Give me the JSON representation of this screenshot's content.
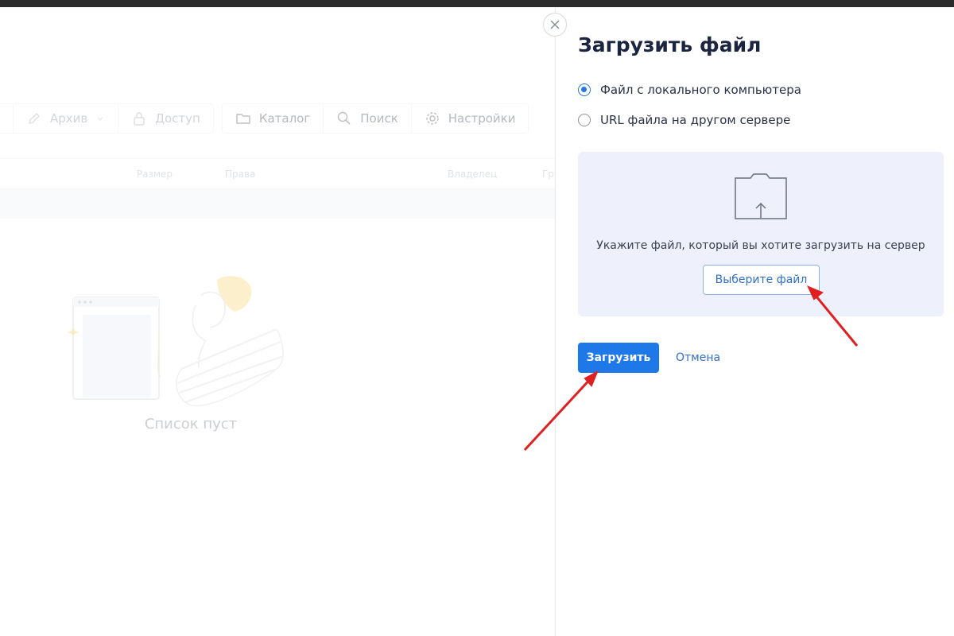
{
  "toolbar": {
    "archive_label": "Архив",
    "access_label": "Доступ",
    "catalog_label": "Каталог",
    "search_label": "Поиск",
    "settings_label": "Настройки"
  },
  "table": {
    "columns": [
      "Размер",
      "Права",
      "Владелец",
      "Гру"
    ]
  },
  "empty_state": {
    "label": "Список пуст"
  },
  "panel": {
    "title": "Загрузить файл",
    "options": [
      {
        "label": "Файл с локального компьютера",
        "selected": true
      },
      {
        "label": "URL файла на другом сервере",
        "selected": false
      }
    ],
    "dropzone_text": "Укажите файл, который вы хотите загрузить на сервер",
    "choose_button": "Выберите файл",
    "upload_button": "Загрузить",
    "cancel_link": "Отмена"
  },
  "colors": {
    "accent": "#1f78e8",
    "dropzone_bg": "#eef0fb",
    "annotation_arrow": "#e02020",
    "illustration_hair": "#f5d16a"
  },
  "icons": [
    "pencil-icon",
    "lock-icon",
    "folder-icon",
    "search-icon",
    "gear-icon",
    "close-icon",
    "folder-upload-icon"
  ]
}
